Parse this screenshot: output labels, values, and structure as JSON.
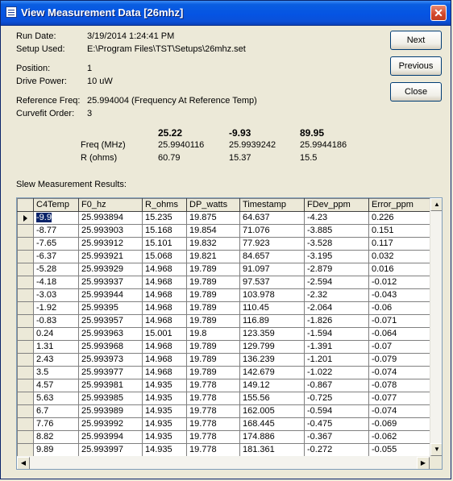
{
  "window": {
    "title": "View Measurement Data [26mhz]",
    "close_glyph": "✕"
  },
  "info": {
    "run_date": {
      "label": "Run Date:",
      "value": "3/19/2014 1:24:41 PM"
    },
    "setup_used": {
      "label": "Setup Used:",
      "value": "E:\\Program Files\\TST\\Setups\\26mhz.set"
    },
    "position": {
      "label": "Position:",
      "value": "1"
    },
    "drive_power": {
      "label": "Drive Power:",
      "value": "10 uW"
    },
    "reference_freq": {
      "label": "Reference Freq:",
      "value": "25.994004  (Frequency At Reference Temp)"
    },
    "curvefit_order": {
      "label": "Curvefit Order:",
      "value": "3"
    }
  },
  "buttons": {
    "next": "Next",
    "previous": "Previous",
    "close": "Close"
  },
  "summary": {
    "row_labels": [
      "Freq (MHz)",
      "R (ohms)"
    ],
    "columns": [
      {
        "temp": "25.22",
        "freq": "25.9940116",
        "r": "60.79"
      },
      {
        "temp": "-9.93",
        "freq": "25.9939242",
        "r": "15.37"
      },
      {
        "temp": "89.95",
        "freq": "25.9944186",
        "r": "15.5"
      }
    ]
  },
  "slew_label": "Slew Measurement Results:",
  "table": {
    "headers": [
      "C4Temp",
      "F0_hz",
      "R_ohms",
      "DP_watts",
      "Timestamp",
      "FDev_ppm",
      "Error_ppm"
    ],
    "rows": [
      [
        "-9.9",
        "25.993894",
        "15.235",
        "19.875",
        "64.637",
        "-4.23",
        "0.226"
      ],
      [
        "-8.77",
        "25.993903",
        "15.168",
        "19.854",
        "71.076",
        "-3.885",
        "0.151"
      ],
      [
        "-7.65",
        "25.993912",
        "15.101",
        "19.832",
        "77.923",
        "-3.528",
        "0.117"
      ],
      [
        "-6.37",
        "25.993921",
        "15.068",
        "19.821",
        "84.657",
        "-3.195",
        "0.032"
      ],
      [
        "-5.28",
        "25.993929",
        "14.968",
        "19.789",
        "91.097",
        "-2.879",
        "0.016"
      ],
      [
        "-4.18",
        "25.993937",
        "14.968",
        "19.789",
        "97.537",
        "-2.594",
        "-0.012"
      ],
      [
        "-3.03",
        "25.993944",
        "14.968",
        "19.789",
        "103.978",
        "-2.32",
        "-0.043"
      ],
      [
        "-1.92",
        "25.99395",
        "14.968",
        "19.789",
        "110.45",
        "-2.064",
        "-0.06"
      ],
      [
        "-0.83",
        "25.993957",
        "14.968",
        "19.789",
        "116.89",
        "-1.826",
        "-0.071"
      ],
      [
        "0.24",
        "25.993963",
        "15.001",
        "19.8",
        "123.359",
        "-1.594",
        "-0.064"
      ],
      [
        "1.31",
        "25.993968",
        "14.968",
        "19.789",
        "129.799",
        "-1.391",
        "-0.07"
      ],
      [
        "2.43",
        "25.993973",
        "14.968",
        "19.789",
        "136.239",
        "-1.201",
        "-0.079"
      ],
      [
        "3.5",
        "25.993977",
        "14.968",
        "19.789",
        "142.679",
        "-1.022",
        "-0.074"
      ],
      [
        "4.57",
        "25.993981",
        "14.935",
        "19.778",
        "149.12",
        "-0.867",
        "-0.078"
      ],
      [
        "5.63",
        "25.993985",
        "14.935",
        "19.778",
        "155.56",
        "-0.725",
        "-0.077"
      ],
      [
        "6.7",
        "25.993989",
        "14.935",
        "19.778",
        "162.005",
        "-0.594",
        "-0.074"
      ],
      [
        "7.76",
        "25.993992",
        "14.935",
        "19.778",
        "168.445",
        "-0.475",
        "-0.069"
      ],
      [
        "8.82",
        "25.993994",
        "14.935",
        "19.778",
        "174.886",
        "-0.367",
        "-0.062"
      ],
      [
        "9.89",
        "25.993997",
        "14.935",
        "19.778",
        "181.361",
        "-0.272",
        "-0.055"
      ]
    ]
  },
  "icons": {
    "title_icon": "form-icon",
    "row_pointer": "row-pointer-icon"
  }
}
